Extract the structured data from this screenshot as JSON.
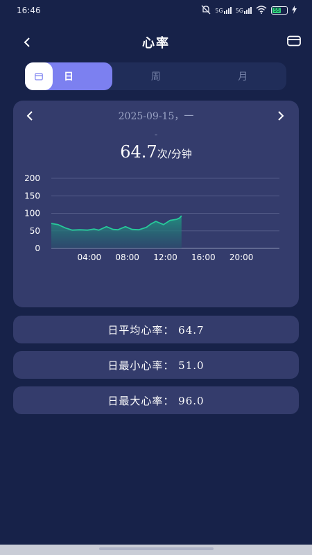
{
  "status_bar": {
    "time": "16:46",
    "network_1": "5G",
    "network_2": "5G",
    "battery": "55"
  },
  "header": {
    "title": "心率"
  },
  "tabs": [
    {
      "label": "日",
      "active": true
    },
    {
      "label": "周",
      "active": false
    },
    {
      "label": "月",
      "active": false
    }
  ],
  "chart_card": {
    "date": "2025-09-15，一",
    "dash": "-",
    "value": "64.7",
    "unit": "次/分钟"
  },
  "chart_data": {
    "type": "area",
    "ylim": [
      0,
      200
    ],
    "yticks": [
      "0",
      "50",
      "100",
      "150",
      "200"
    ],
    "xticks": [
      "04:00",
      "08:00",
      "12:00",
      "16:00",
      "20:00"
    ],
    "xlim": [
      0,
      24
    ],
    "x": [
      0.0,
      0.7,
      1.5,
      2.2,
      3.0,
      3.8,
      4.5,
      5.0,
      5.8,
      6.5,
      7.0,
      7.8,
      8.5,
      9.2,
      10.0,
      10.5,
      11.0,
      11.8,
      12.5,
      13.2,
      13.5,
      13.7
    ],
    "values": [
      71,
      68,
      58,
      52,
      53,
      52,
      55,
      52,
      62,
      54,
      53,
      62,
      54,
      53,
      60,
      70,
      77,
      68,
      80,
      83,
      87,
      93
    ],
    "line_color": "#27c99a",
    "fill_color": "#1f8f7f"
  },
  "stats": {
    "avg": "日平均心率： 64.7",
    "min": "日最小心率： 51.0",
    "max": "日最大心率： 96.0"
  }
}
